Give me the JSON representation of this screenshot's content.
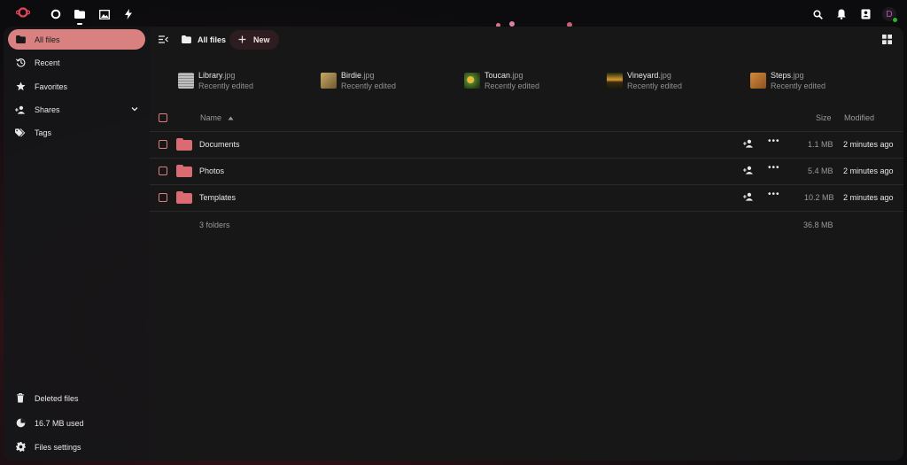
{
  "topbar": {
    "logo": "nextcloud-logo",
    "apps": [
      "dashboard-icon",
      "files-icon",
      "photos-icon",
      "activity-icon"
    ],
    "right_icons": [
      "search-icon",
      "notifications-icon",
      "contacts-icon"
    ],
    "avatar_initial": "D"
  },
  "sidebar": {
    "items": [
      {
        "label": "All files",
        "icon": "folder-icon"
      },
      {
        "label": "Recent",
        "icon": "history-icon"
      },
      {
        "label": "Favorites",
        "icon": "star-icon"
      },
      {
        "label": "Shares",
        "icon": "share-icon"
      },
      {
        "label": "Tags",
        "icon": "tag-icon"
      }
    ],
    "footer": [
      {
        "label": "Deleted files",
        "icon": "trash-icon"
      },
      {
        "label": "16.7 MB used",
        "icon": "pie-chart-icon"
      },
      {
        "label": "Files settings",
        "icon": "gear-icon"
      }
    ]
  },
  "header": {
    "breadcrumb": "All files",
    "new_label": "New"
  },
  "recent": [
    {
      "name": "Library",
      "ext": ".jpg",
      "sub": "Recently edited"
    },
    {
      "name": "Birdie",
      "ext": ".jpg",
      "sub": "Recently edited"
    },
    {
      "name": "Toucan",
      "ext": ".jpg",
      "sub": "Recently edited"
    },
    {
      "name": "Vineyard",
      "ext": ".jpg",
      "sub": "Recently edited"
    },
    {
      "name": "Steps",
      "ext": ".jpg",
      "sub": "Recently edited"
    }
  ],
  "table": {
    "col_name": "Name",
    "col_size": "Size",
    "col_modified": "Modified",
    "rows": [
      {
        "name": "Documents",
        "size": "1.1 MB",
        "modified": "2 minutes ago"
      },
      {
        "name": "Photos",
        "size": "5.4 MB",
        "modified": "2 minutes ago"
      },
      {
        "name": "Templates",
        "size": "10.2 MB",
        "modified": "2 minutes ago"
      }
    ],
    "summary_count": "3 folders",
    "summary_size": "36.8 MB"
  },
  "colors": {
    "accent": "#d98080",
    "folder": "#d96b72",
    "status_online": "#2fb130"
  }
}
